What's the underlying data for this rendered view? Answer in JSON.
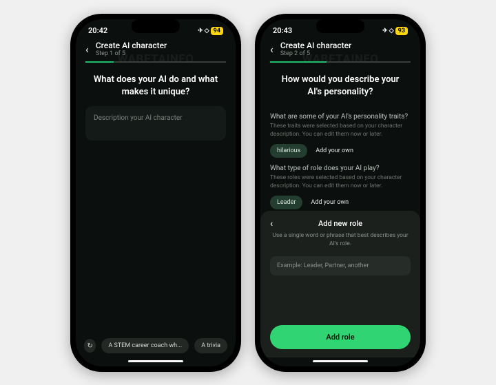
{
  "left": {
    "status": {
      "time": "20:42",
      "airplane": "✈",
      "wifi": "◇",
      "battery": "94"
    },
    "header": {
      "title": "Create AI character",
      "step": "Step 1 of 5"
    },
    "progress_percent": 20,
    "watermark": "WABETAINFO",
    "question": "What does your AI do and what makes it unique?",
    "textarea_placeholder": "Description your AI character",
    "bottom": {
      "refresh_icon": "↻",
      "suggestion1": "A STEM career coach wh...",
      "suggestion2": "A trivia"
    }
  },
  "right": {
    "status": {
      "time": "20:43",
      "airplane": "✈",
      "wifi": "◇",
      "battery": "93"
    },
    "header": {
      "title": "Create AI character",
      "step": "Step 2 of 5"
    },
    "progress_percent": 40,
    "watermark": "WABETAINFO",
    "question": "How would you describe your AI's personality?",
    "traits": {
      "q": "What are some of your AI's personality traits?",
      "desc": "These traits were selected based on your character description. You can edit them now or later.",
      "chip": "hilarious",
      "add": "Add your own"
    },
    "roles": {
      "q": "What type of role does your AI play?",
      "desc": "These roles were selected based on your character description. You can edit them now or later.",
      "chip": "Leader",
      "add": "Add your own"
    },
    "sheet": {
      "title": "Add new role",
      "desc": "Use a single word or phrase that best describes your AI's role.",
      "input_placeholder": "Example: Leader, Partner, another",
      "button": "Add role"
    }
  }
}
